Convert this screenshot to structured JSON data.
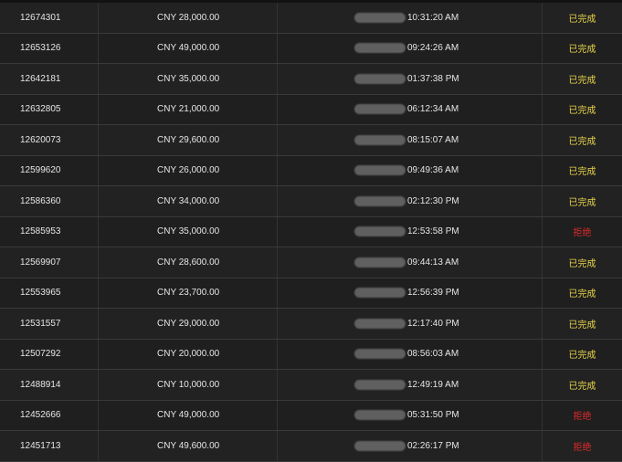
{
  "rows": [
    {
      "id": "12674301",
      "amount": "CNY 28,000.00",
      "time": "10:31:20 AM",
      "status": "已完成",
      "status_type": "done"
    },
    {
      "id": "12653126",
      "amount": "CNY 49,000.00",
      "time": "09:24:26 AM",
      "status": "已完成",
      "status_type": "done"
    },
    {
      "id": "12642181",
      "amount": "CNY 35,000.00",
      "time": "01:37:38 PM",
      "status": "已完成",
      "status_type": "done"
    },
    {
      "id": "12632805",
      "amount": "CNY 21,000.00",
      "time": "06:12:34 AM",
      "status": "已完成",
      "status_type": "done"
    },
    {
      "id": "12620073",
      "amount": "CNY 29,600.00",
      "time": "08:15:07 AM",
      "status": "已完成",
      "status_type": "done"
    },
    {
      "id": "12599620",
      "amount": "CNY 26,000.00",
      "time": "09:49:36 AM",
      "status": "已完成",
      "status_type": "done"
    },
    {
      "id": "12586360",
      "amount": "CNY 34,000.00",
      "time": "02:12:30 PM",
      "status": "已完成",
      "status_type": "done"
    },
    {
      "id": "12585953",
      "amount": "CNY 35,000.00",
      "time": "12:53:58 PM",
      "status": "拒绝",
      "status_type": "reject"
    },
    {
      "id": "12569907",
      "amount": "CNY 28,600.00",
      "time": "09:44:13 AM",
      "status": "已完成",
      "status_type": "done"
    },
    {
      "id": "12553965",
      "amount": "CNY 23,700.00",
      "time": "12:56:39 PM",
      "status": "已完成",
      "status_type": "done"
    },
    {
      "id": "12531557",
      "amount": "CNY 29,000.00",
      "time": "12:17:40 PM",
      "status": "已完成",
      "status_type": "done"
    },
    {
      "id": "12507292",
      "amount": "CNY 20,000.00",
      "time": "08:56:03 AM",
      "status": "已完成",
      "status_type": "done"
    },
    {
      "id": "12488914",
      "amount": "CNY 10,000.00",
      "time": "12:49:19 AM",
      "status": "已完成",
      "status_type": "done"
    },
    {
      "id": "12452666",
      "amount": "CNY 49,000.00",
      "time": "05:31:50 PM",
      "status": "拒绝",
      "status_type": "reject"
    },
    {
      "id": "12451713",
      "amount": "CNY 49,600.00",
      "time": "02:26:17 PM",
      "status": "拒绝",
      "status_type": "reject"
    }
  ],
  "colors": {
    "background": "#202020",
    "status_done": "#e8d44a",
    "status_reject": "#e02a2a",
    "redaction": "#6b6b6b"
  }
}
